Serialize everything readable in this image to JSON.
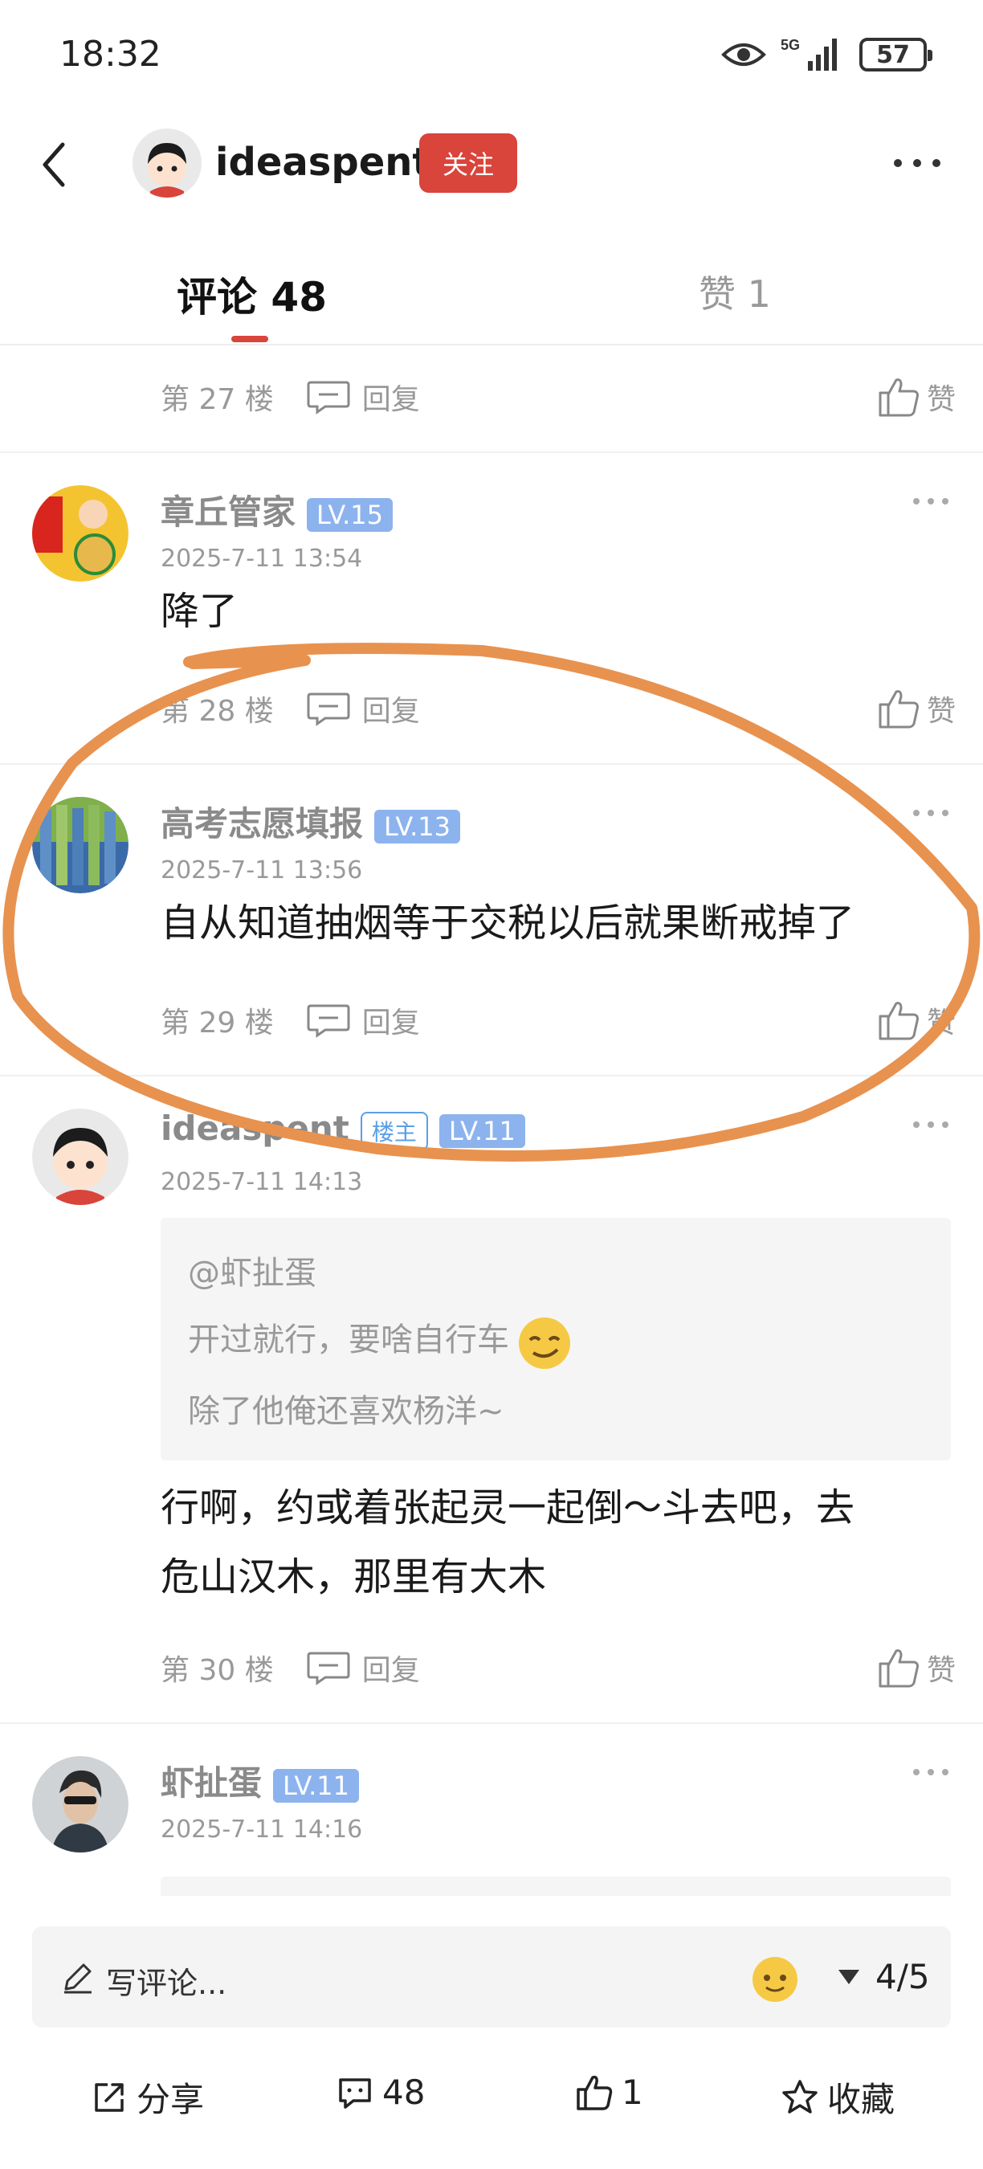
{
  "status_bar": {
    "time": "18:32",
    "network": "5G",
    "battery": "57"
  },
  "header": {
    "username": "ideaspent",
    "follow_label": "关注"
  },
  "tabs": [
    {
      "label": "评论 48",
      "active": true
    },
    {
      "label": "赞 1",
      "active": false
    }
  ],
  "comments": [
    {
      "floor": "第 27 楼",
      "reply_label": "回复",
      "like_label": "赞"
    },
    {
      "username": "章丘管家",
      "level": "LV.15",
      "time": "2025-7-11 13:54",
      "text": "降了",
      "floor": "第 28 楼",
      "reply_label": "回复",
      "like_label": "赞"
    },
    {
      "username": "高考志愿填报",
      "level": "LV.13",
      "time": "2025-7-11 13:56",
      "text": "自从知道抽烟等于交税以后就果断戒掉了",
      "floor": "第 29 楼",
      "reply_label": "回复",
      "like_label": "赞"
    },
    {
      "username": "ideaspent",
      "host_badge": "楼主",
      "level": "LV.11",
      "time": "2025-7-11 14:13",
      "quote": {
        "at": "@虾扯蛋",
        "line1": "开过就行，要啥自行车",
        "line2": "除了他俺还喜欢杨洋~"
      },
      "text_line1": "行啊，约或着张起灵一起倒～斗去吧，去",
      "text_line2": "危山汉木，那里有大木",
      "floor": "第 30 楼",
      "reply_label": "回复",
      "like_label": "赞"
    },
    {
      "username": "虾扯蛋",
      "level": "LV.11",
      "time": "2025-7-11 14:16"
    }
  ],
  "composer": {
    "placeholder": "写评论...",
    "page_indicator": "4/5"
  },
  "bottom_nav": {
    "share": "分享",
    "comments": "48",
    "likes": "1",
    "favorite": "收藏"
  },
  "colors": {
    "accent": "#d9443b",
    "level_badge": "#8db3ee",
    "annotation": "#e8924f"
  }
}
